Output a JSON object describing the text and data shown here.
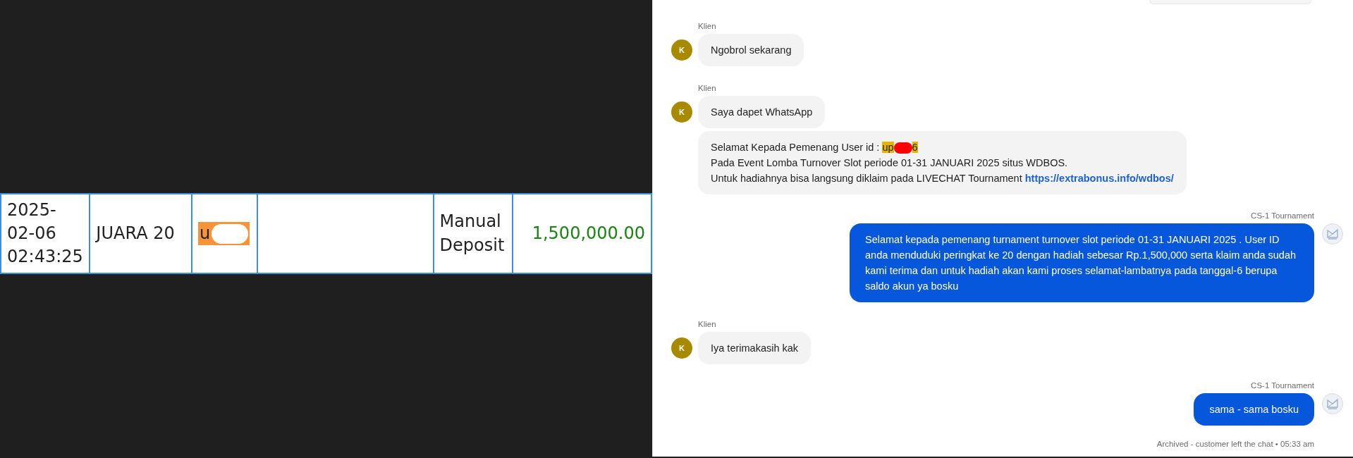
{
  "table": {
    "rows": [
      {
        "cells": [
          {
            "kind": "lines",
            "lines": [
              "2025-",
              "02-06",
              "02:43:25"
            ]
          },
          {
            "kind": "text",
            "text": "JUARA 20"
          },
          {
            "kind": "redacted",
            "text": "u"
          },
          {
            "kind": "empty"
          },
          {
            "kind": "lines",
            "lines": [
              "Manual",
              "Deposit"
            ]
          },
          {
            "kind": "amount",
            "text": "1,500,000.00"
          }
        ]
      }
    ]
  },
  "chat": {
    "messages": [
      {
        "kind": "cut"
      },
      {
        "kind": "incoming",
        "sender": "Klien",
        "avatar": "K",
        "bubbles": [
          {
            "kind": "text",
            "text": "Ngobrol sekarang"
          }
        ]
      },
      {
        "kind": "incoming",
        "sender": "Klien",
        "avatar": "K",
        "bubbles": [
          {
            "kind": "text",
            "text": "Saya dapet WhatsApp"
          },
          {
            "kind": "quote",
            "lines": [
              {
                "kind": "id",
                "text": "Selamat Kepada Pemenang User id : ",
                "id_prefix": "up",
                "id_suffix": "6"
              },
              {
                "kind": "text",
                "text": "Pada Event Lomba Turnover Slot periode 01-31 JANUARI 2025 situs WDBOS."
              },
              {
                "kind": "link",
                "text": "Untuk hadiahnya bisa langsung diklaim pada LIVECHAT Tournament ",
                "link": "https://extrabonus.info/wdbos/"
              }
            ]
          }
        ]
      },
      {
        "kind": "outgoing",
        "sender": "CS-1 Tournament",
        "bubbles": [
          {
            "kind": "text",
            "text": "Selamat kepada pemenang turnament turnover slot periode 01-31 JANUARI 2025 . User ID anda menduduki peringkat ke 20 dengan hadiah sebesar Rp.1,500,000 serta klaim anda sudah kami terima dan untuk hadiah akan kami proses selamat-lambatnya pada tanggal-6 berupa saldo akun ya bosku"
          }
        ]
      },
      {
        "kind": "incoming",
        "sender": "Klien",
        "avatar": "K",
        "bubbles": [
          {
            "kind": "text",
            "text": "Iya terimakasih kak"
          }
        ]
      },
      {
        "kind": "outgoing",
        "sender": "CS-1 Tournament",
        "bubbles": [
          {
            "kind": "text",
            "text": "sama - sama bosku"
          }
        ]
      }
    ],
    "status": {
      "text": "Archived - customer left the chat",
      "separator": "•",
      "time": "05:33 am"
    }
  }
}
